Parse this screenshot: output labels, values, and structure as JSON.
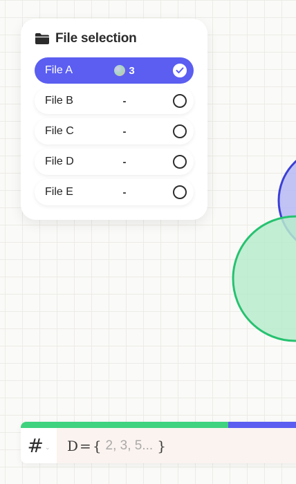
{
  "file_selection": {
    "title": "File selection",
    "icon": "folder-icon",
    "files": [
      {
        "label": "File A",
        "count": "3",
        "selected": true
      },
      {
        "label": "File B",
        "count": "-",
        "selected": false
      },
      {
        "label": "File C",
        "count": "-",
        "selected": false
      },
      {
        "label": "File D",
        "count": "-",
        "selected": false
      },
      {
        "label": "File E",
        "count": "-",
        "selected": false
      }
    ]
  },
  "formula": {
    "hash_symbol": "#",
    "chevron": "⌄",
    "set_name": "D",
    "equals": "=",
    "open_brace": "{",
    "placeholder": "2, 3, 5...",
    "close_brace": "}"
  },
  "colors": {
    "accent_blue": "#5b5ef0",
    "accent_green": "#3fd27f",
    "circle_blue_fill": "#b6b9f5",
    "circle_green_fill": "#b7ebcd"
  }
}
